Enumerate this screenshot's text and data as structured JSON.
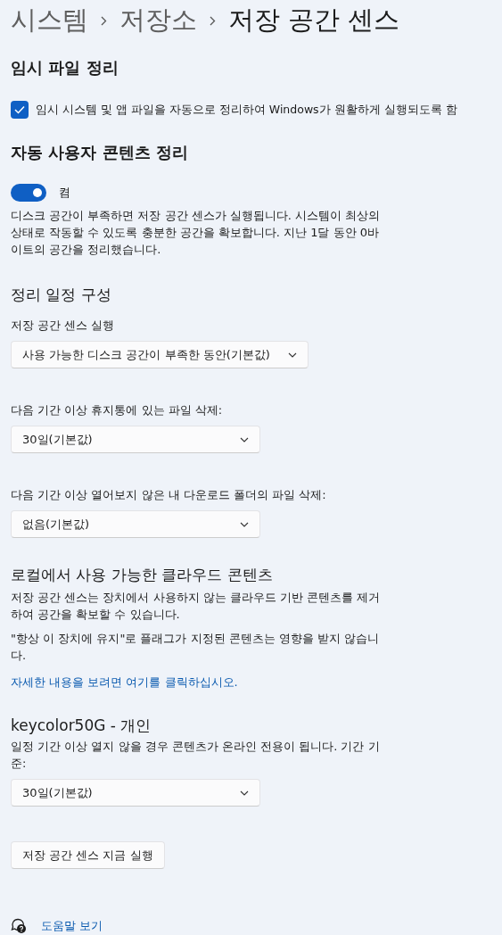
{
  "breadcrumb": [
    {
      "label": "시스템",
      "current": false
    },
    {
      "label": "저장소",
      "current": false
    },
    {
      "label": "저장 공간 센스",
      "current": true
    }
  ],
  "temp_files": {
    "title": "임시 파일 정리",
    "checkbox": {
      "label": "임시 시스템 및 앱 파일을 자동으로 정리하여 Windows가 원활하게 실행되도록 함",
      "checked": true
    }
  },
  "auto_cleanup": {
    "title": "자동 사용자 콘텐츠 정리",
    "toggle": {
      "label": "켬",
      "on": true
    },
    "description": "디스크 공간이 부족하면 저장 공간 센스가 실행됩니다. 시스템이 최상의 상태로 작동할 수 있도록 충분한 공간을 확보합니다. 지난 1달 동안 0바이트의 공간을 정리했습니다."
  },
  "schedule": {
    "title": "정리 일정 구성",
    "dropdowns": [
      {
        "label": "저장 공간 센스 실행",
        "value": "사용 가능한 디스크 공간이 부족한 동안(기본값)"
      },
      {
        "label": "다음 기간 이상 휴지통에 있는 파일 삭제:",
        "value": "30일(기본값)"
      },
      {
        "label": "다음 기간 이상 열어보지 않은 내 다운로드 폴더의 파일 삭제:",
        "value": "없음(기본값)"
      }
    ]
  },
  "cloud": {
    "title": "로컬에서 사용 가능한 클라우드 콘텐츠",
    "paragraphs": [
      "저장 공간 센스는 장치에서 사용하지 않는 클라우드 기반 콘텐츠를 제거하여 공간을 확보할 수 있습니다.",
      "\"항상 이 장치에 유지\"로 플래그가 지정된 콘텐츠는 영향을 받지 않습니다."
    ],
    "link": "자세한 내용을 보려면 여기를 클릭하십시오."
  },
  "account": {
    "title": "keycolor50G - 개인",
    "description": "일정 기간 이상 열지 않을 경우 콘텐츠가 온라인 전용이 됩니다. 기간 기준:",
    "dropdown": {
      "value": "30일(기본값)"
    }
  },
  "run_button": "저장 공간 센스 지금 실행",
  "help_link": "도움말 보기"
}
